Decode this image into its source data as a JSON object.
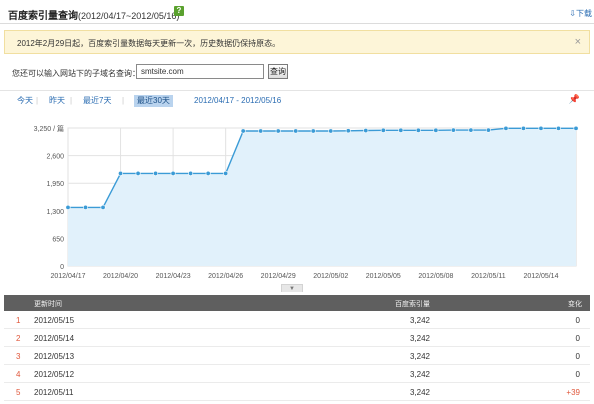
{
  "header": {
    "title": "百度索引量查询",
    "range": "(2012/04/17~2012/05/16)",
    "help": "?",
    "download": "下载"
  },
  "notice": {
    "text": "2012年2月29日起，百度索引量数据每天更新一次，历史数据仍保持原态。",
    "close": "×"
  },
  "search": {
    "label": "您还可以输入网站下的子域名查询：",
    "value": "smtsite.com",
    "button": "查询"
  },
  "filters": {
    "items": [
      "今天",
      "昨天",
      "最近7天",
      "最近30天"
    ],
    "active": 3,
    "range": "2012/04/17 - 2012/05/16"
  },
  "colors": {
    "line": "#3b9bd6",
    "fill": "#e1f1fb",
    "accent": "#e0573b",
    "table_header": "#5f5f5f"
  },
  "icons": {
    "help": "help-icon",
    "download": "download-icon",
    "close": "close-icon",
    "pin": "pin-icon"
  },
  "chart_data": {
    "type": "area",
    "title": "",
    "xlabel": "",
    "ylabel": "",
    "ylim": [
      0,
      3250
    ],
    "y_ticks": [
      "3,250 / 篇",
      "2,600",
      "1,950",
      "1,300",
      "650",
      "0"
    ],
    "x_ticks": [
      "2012/04/17",
      "2012/04/20",
      "2012/04/23",
      "2012/04/26",
      "2012/04/29",
      "2012/05/02",
      "2012/05/05",
      "2012/05/08",
      "2012/05/11",
      "2012/05/14"
    ],
    "x": [
      "2012/04/17",
      "2012/04/18",
      "2012/04/19",
      "2012/04/20",
      "2012/04/21",
      "2012/04/22",
      "2012/04/23",
      "2012/04/24",
      "2012/04/25",
      "2012/04/26",
      "2012/04/27",
      "2012/04/28",
      "2012/04/29",
      "2012/04/30",
      "2012/05/01",
      "2012/05/02",
      "2012/05/03",
      "2012/05/04",
      "2012/05/05",
      "2012/05/06",
      "2012/05/07",
      "2012/05/08",
      "2012/05/09",
      "2012/05/10",
      "2012/05/11",
      "2012/05/12",
      "2012/05/13",
      "2012/05/14",
      "2012/05/15",
      "2012/05/16"
    ],
    "series": [
      {
        "values": [
          1380,
          1380,
          1380,
          2180,
          2180,
          2180,
          2180,
          2180,
          2180,
          2180,
          3180,
          3180,
          3180,
          3180,
          3180,
          3180,
          3185,
          3190,
          3195,
          3195,
          3195,
          3195,
          3200,
          3200,
          3200,
          3242,
          3242,
          3242,
          3242,
          3242
        ]
      }
    ],
    "grid": true
  },
  "table": {
    "headers": [
      "更新时间",
      "百度索引量",
      "变化"
    ],
    "rows": [
      {
        "index": "1",
        "date": "2012/05/15",
        "value": "3,242",
        "change": "0"
      },
      {
        "index": "2",
        "date": "2012/05/14",
        "value": "3,242",
        "change": "0"
      },
      {
        "index": "3",
        "date": "2012/05/13",
        "value": "3,242",
        "change": "0"
      },
      {
        "index": "4",
        "date": "2012/05/12",
        "value": "3,242",
        "change": "0"
      },
      {
        "index": "5",
        "date": "2012/05/11",
        "value": "3,242",
        "change": "+39"
      }
    ]
  }
}
